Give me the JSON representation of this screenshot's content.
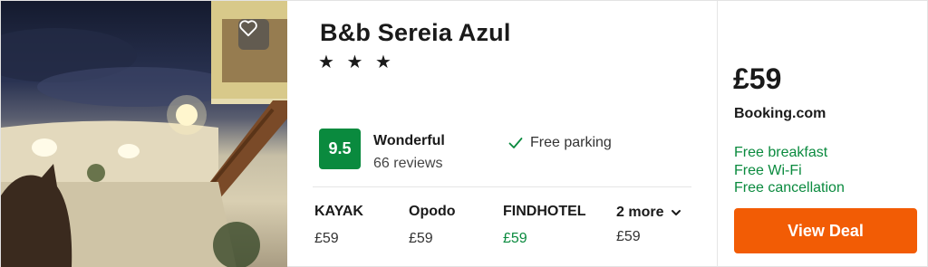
{
  "hotel": {
    "name": "B&b Sereia Azul",
    "stars": "★ ★ ★",
    "favorite_icon": "heart-outline-icon"
  },
  "rating": {
    "score": "9.5",
    "label": "Wonderful",
    "reviews": "66 reviews",
    "badge_color": "#0a8a3e"
  },
  "amenity": {
    "label": "Free parking",
    "icon": "check-icon"
  },
  "providers": [
    {
      "name": "KAYAK",
      "price": "£59"
    },
    {
      "name": "Opodo",
      "price": "£59"
    },
    {
      "name": "FINDHOTEL",
      "price": "£59",
      "highlight_color": "#0a8a3e"
    }
  ],
  "more": {
    "label": "2 more",
    "price": "£59",
    "icon": "chevron-down-icon"
  },
  "best_deal": {
    "price": "£59",
    "provider": "Booking.com",
    "perks": [
      "Free breakfast",
      "Free Wi-Fi",
      "Free cancellation"
    ],
    "button_label": "View Deal",
    "button_color": "#f25c05"
  }
}
